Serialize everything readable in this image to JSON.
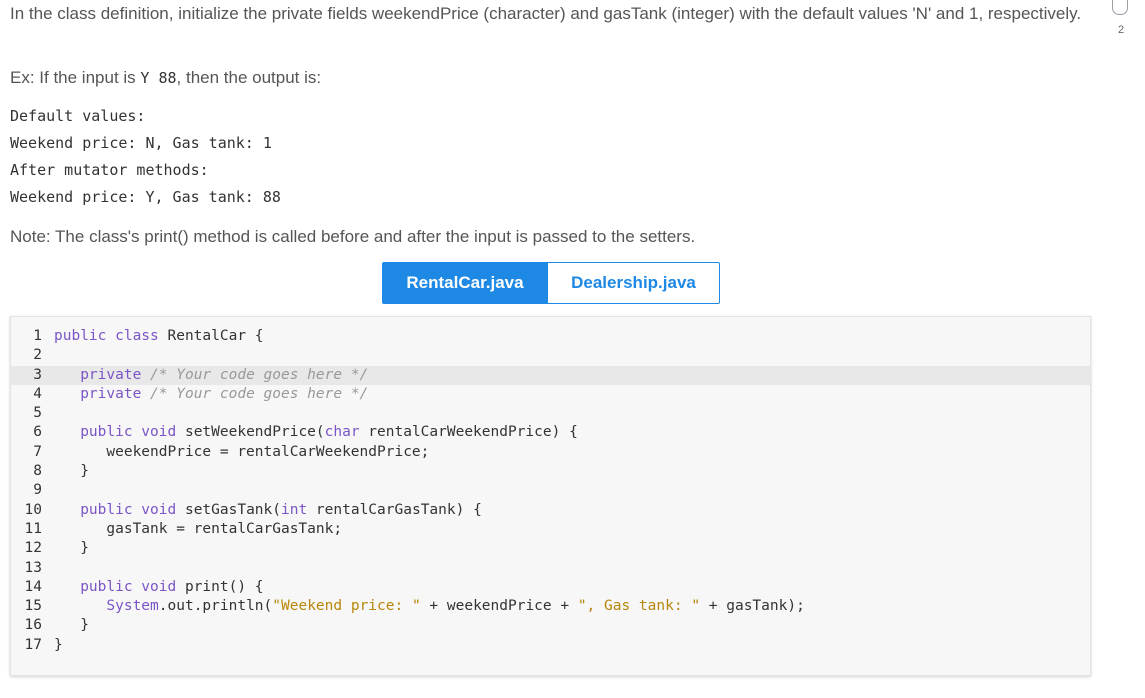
{
  "prompt": {
    "intro": "In the class definition, initialize the private fields weekendPrice (character) and gasTank (integer) with the default values 'N' and 1, respectively.",
    "example_prefix": "Ex: If the input is ",
    "example_input": "Y 88",
    "example_suffix": ", then the output is:",
    "output_lines": [
      "Default values:",
      "Weekend price: N, Gas tank: 1",
      "After mutator methods:",
      "Weekend price: Y, Gas tank: 88"
    ],
    "note": "Note: The class's print() method is called before and after the input is passed to the setters."
  },
  "badge": {
    "count": "2"
  },
  "tabs": [
    {
      "label": "RentalCar.java",
      "active": true
    },
    {
      "label": "Dealership.java",
      "active": false
    }
  ],
  "editor": {
    "lines": [
      {
        "n": "1",
        "tokens": [
          [
            "kw",
            "public class"
          ],
          [
            "tx",
            " RentalCar {"
          ]
        ]
      },
      {
        "n": "2",
        "tokens": []
      },
      {
        "n": "3",
        "tokens": [
          [
            "tx",
            "   "
          ],
          [
            "kw",
            "private"
          ],
          [
            "cm",
            " /* Your code goes here */"
          ]
        ],
        "highlight": true
      },
      {
        "n": "4",
        "tokens": [
          [
            "tx",
            "   "
          ],
          [
            "kw",
            "private"
          ],
          [
            "cm",
            " /* Your code goes here */"
          ]
        ]
      },
      {
        "n": "5",
        "tokens": []
      },
      {
        "n": "6",
        "tokens": [
          [
            "tx",
            "   "
          ],
          [
            "kw",
            "public void"
          ],
          [
            "tx",
            " setWeekendPrice("
          ],
          [
            "kw",
            "char"
          ],
          [
            "tx",
            " rentalCarWeekendPrice) {"
          ]
        ]
      },
      {
        "n": "7",
        "tokens": [
          [
            "tx",
            "      weekendPrice = rentalCarWeekendPrice;"
          ]
        ]
      },
      {
        "n": "8",
        "tokens": [
          [
            "tx",
            "   }"
          ]
        ]
      },
      {
        "n": "9",
        "tokens": []
      },
      {
        "n": "10",
        "tokens": [
          [
            "tx",
            "   "
          ],
          [
            "kw",
            "public void"
          ],
          [
            "tx",
            " setGasTank("
          ],
          [
            "kw",
            "int"
          ],
          [
            "tx",
            " rentalCarGasTank) {"
          ]
        ]
      },
      {
        "n": "11",
        "tokens": [
          [
            "tx",
            "      gasTank = rentalCarGasTank;"
          ]
        ]
      },
      {
        "n": "12",
        "tokens": [
          [
            "tx",
            "   }"
          ]
        ]
      },
      {
        "n": "13",
        "tokens": []
      },
      {
        "n": "14",
        "tokens": [
          [
            "tx",
            "   "
          ],
          [
            "kw",
            "public void"
          ],
          [
            "tx",
            " print() {"
          ]
        ]
      },
      {
        "n": "15",
        "tokens": [
          [
            "tx",
            "      "
          ],
          [
            "kw",
            "System"
          ],
          [
            "tx",
            ".out.println("
          ],
          [
            "st",
            "\"Weekend price: \""
          ],
          [
            "tx",
            " + weekendPrice + "
          ],
          [
            "st",
            "\", Gas tank: \""
          ],
          [
            "tx",
            " + gasTank);"
          ]
        ]
      },
      {
        "n": "16",
        "tokens": [
          [
            "tx",
            "   }"
          ]
        ]
      },
      {
        "n": "17",
        "tokens": [
          [
            "tx",
            "}"
          ]
        ]
      }
    ]
  }
}
